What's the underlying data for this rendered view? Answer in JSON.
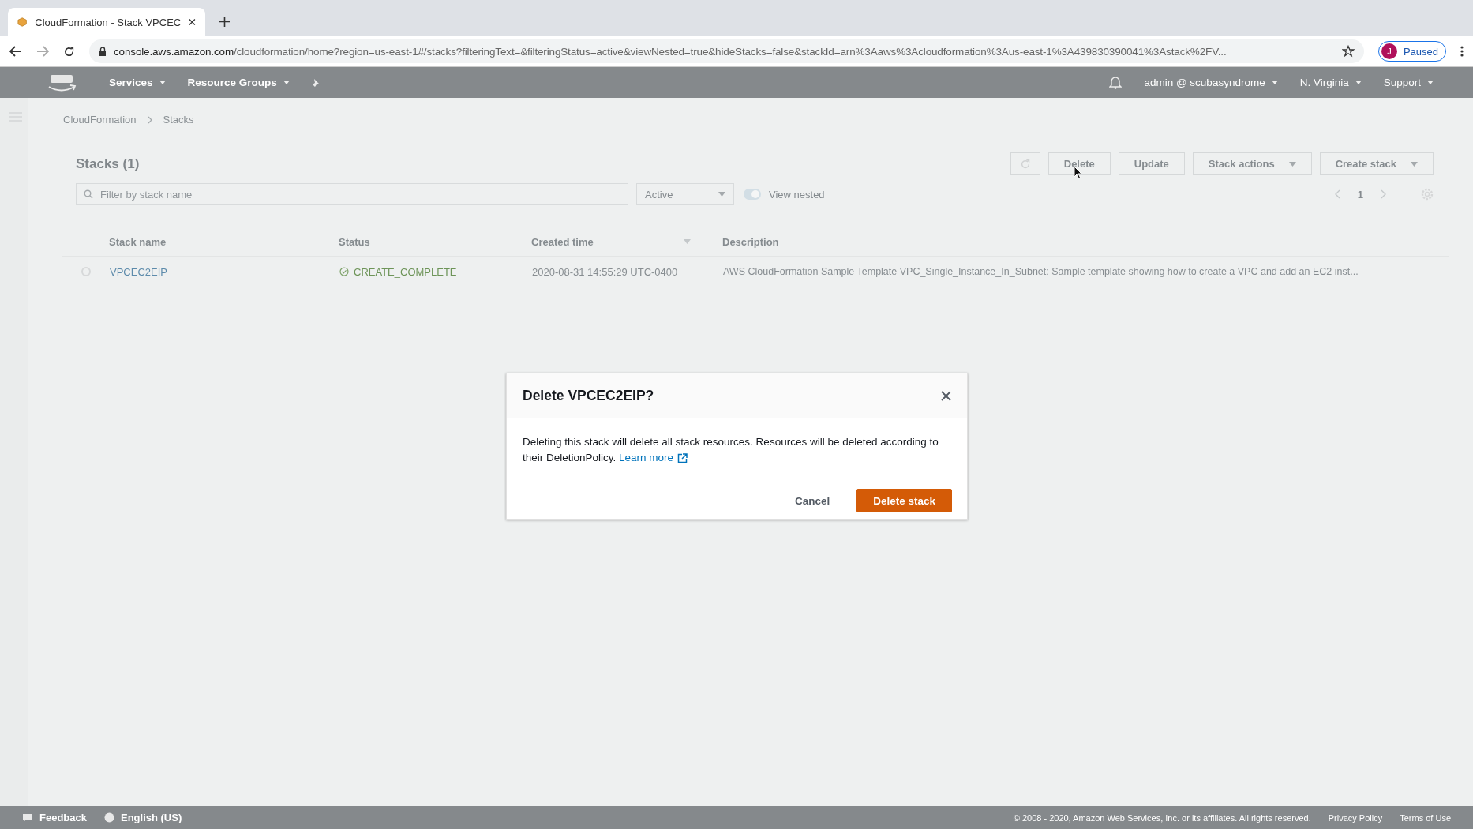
{
  "browser": {
    "tab_title": "CloudFormation - Stack VPCEC",
    "url_host": "console.aws.amazon.com",
    "url_rest": "/cloudformation/home?region=us-east-1#/stacks?filteringText=&filteringStatus=active&viewNested=true&hideStacks=false&stackId=arn%3Aaws%3Acloudformation%3Aus-east-1%3A439830390041%3Astack%2FV...",
    "profile_initial": "J",
    "profile_status": "Paused"
  },
  "header": {
    "nav": [
      "Services",
      "Resource Groups"
    ],
    "user": "admin @ scubasyndrome",
    "region": "N. Virginia",
    "support": "Support"
  },
  "breadcrumbs": [
    "CloudFormation",
    "Stacks"
  ],
  "stacks": {
    "title": "Stacks (1)",
    "buttons": [
      {
        "label": "Delete",
        "has_menu": false
      },
      {
        "label": "Update",
        "has_menu": false
      },
      {
        "label": "Stack actions",
        "has_menu": true
      },
      {
        "label": "Create stack",
        "has_menu": true
      }
    ],
    "filter_placeholder": "Filter by stack name",
    "status_filter": "Active",
    "view_nested": {
      "label": "View nested",
      "on": true
    },
    "page": "1",
    "columns": [
      {
        "label": "Stack name",
        "sortable": false
      },
      {
        "label": "Status",
        "sortable": false
      },
      {
        "label": "Created time",
        "sortable": true
      },
      {
        "label": "Description",
        "sortable": false
      }
    ],
    "rows": [
      {
        "selected": false,
        "name": "VPCEC2EIP",
        "status": "CREATE_COMPLETE",
        "created": "2020-08-31 14:55:29 UTC-0400",
        "description": "AWS CloudFormation Sample Template VPC_Single_Instance_In_Subnet: Sample template showing how to create a VPC and add an EC2 inst..."
      }
    ]
  },
  "dialog": {
    "title": "Delete VPCEC2EIP?",
    "body": "Deleting this stack will delete all stack resources. Resources will be deleted according to their DeletionPolicy.",
    "link": "Learn more",
    "cancel": "Cancel",
    "confirm": "Delete stack"
  },
  "footer": {
    "feedback": "Feedback",
    "language": "English (US)",
    "copyright": "© 2008 - 2020, Amazon Web Services, Inc. or its affiliates. All rights reserved.",
    "links": [
      "Privacy Policy",
      "Terms of Use"
    ]
  }
}
